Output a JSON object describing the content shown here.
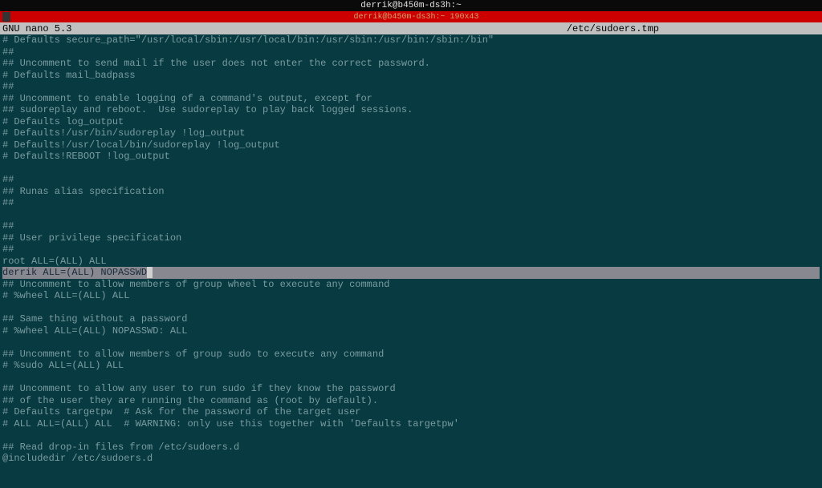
{
  "window": {
    "title": "derrik@b450m-ds3h:~"
  },
  "tab": {
    "label": "derrik@b450m-ds3h:~ 190x43"
  },
  "nano": {
    "version": "  GNU nano 5.3",
    "filename": "/etc/sudoers.tmp"
  },
  "lines": [
    "# Defaults secure_path=\"/usr/local/sbin:/usr/local/bin:/usr/sbin:/usr/bin:/sbin:/bin\"",
    "##",
    "## Uncomment to send mail if the user does not enter the correct password.",
    "# Defaults mail_badpass",
    "##",
    "## Uncomment to enable logging of a command's output, except for",
    "## sudoreplay and reboot.  Use sudoreplay to play back logged sessions.",
    "# Defaults log_output",
    "# Defaults!/usr/bin/sudoreplay !log_output",
    "# Defaults!/usr/local/bin/sudoreplay !log_output",
    "# Defaults!REBOOT !log_output",
    "",
    "##",
    "## Runas alias specification",
    "##",
    "",
    "##",
    "## User privilege specification",
    "##",
    "root ALL=(ALL) ALL"
  ],
  "highlight": {
    "text": "derrik ALL=(ALL) NOPASSWD"
  },
  "lines2": [
    "## Uncomment to allow members of group wheel to execute any command",
    "# %wheel ALL=(ALL) ALL",
    "",
    "## Same thing without a password",
    "# %wheel ALL=(ALL) NOPASSWD: ALL",
    "",
    "## Uncomment to allow members of group sudo to execute any command",
    "# %sudo ALL=(ALL) ALL",
    "",
    "## Uncomment to allow any user to run sudo if they know the password",
    "## of the user they are running the command as (root by default).",
    "# Defaults targetpw  # Ask for the password of the target user",
    "# ALL ALL=(ALL) ALL  # WARNING: only use this together with 'Defaults targetpw'",
    "",
    "## Read drop-in files from /etc/sudoers.d",
    "@includedir /etc/sudoers.d"
  ]
}
